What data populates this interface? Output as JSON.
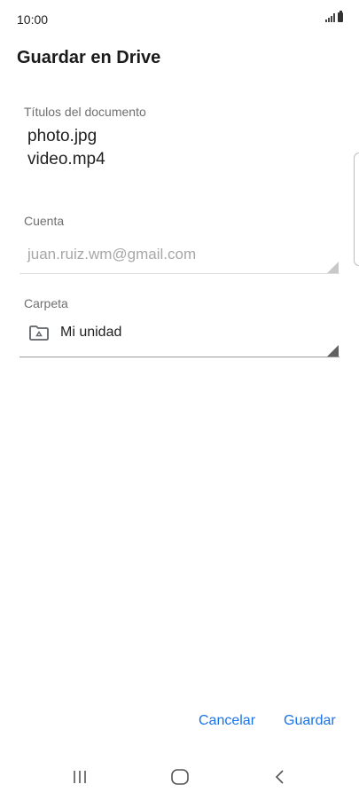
{
  "status": {
    "time": "10:00",
    "signal_icon": "signal-icon",
    "battery_icon": "battery-icon"
  },
  "dialog": {
    "title": "Guardar en Drive",
    "documents": {
      "label": "Títulos del documento",
      "names": [
        "photo.jpg",
        "video.mp4"
      ]
    },
    "account": {
      "label": "Cuenta",
      "value": "juan.ruiz.wm@gmail.com"
    },
    "folder": {
      "label": "Carpeta",
      "value": "Mi unidad",
      "icon": "drive-folder-icon"
    }
  },
  "actions": {
    "cancel": "Cancelar",
    "save": "Guardar"
  },
  "nav": {
    "recents_icon": "recents-icon",
    "home_icon": "home-icon",
    "back_icon": "back-icon"
  },
  "colors": {
    "accent": "#1a73e8",
    "text": "#1f1f1f",
    "muted": "#6f6f6f"
  }
}
